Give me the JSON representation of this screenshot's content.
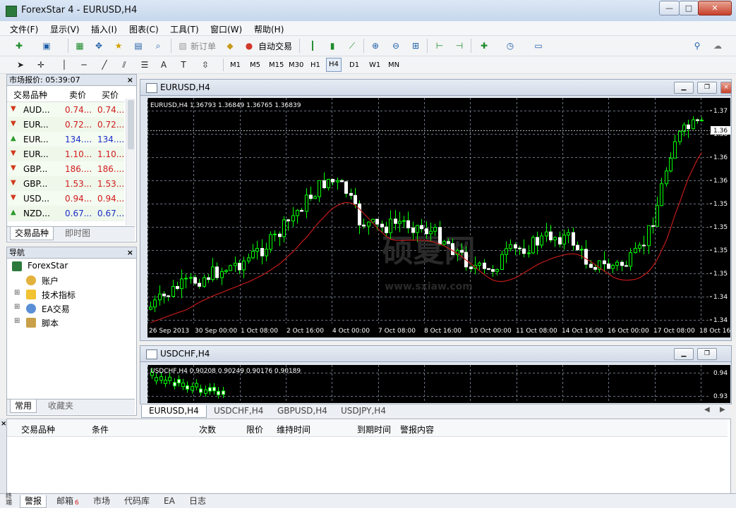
{
  "window": {
    "title": "ForexStar 4 - EURUSD,H4",
    "min": "—",
    "max": "□",
    "close": "✕"
  },
  "menu": [
    "文件(F)",
    "显示(V)",
    "插入(I)",
    "图表(C)",
    "工具(T)",
    "窗口(W)",
    "帮助(H)"
  ],
  "toolbar": {
    "new_order": "新订单",
    "auto_trade": "自动交易"
  },
  "timeframes": [
    "M1",
    "M5",
    "M15",
    "M30",
    "H1",
    "H4",
    "D1",
    "W1",
    "MN"
  ],
  "active_timeframe": "H4",
  "market_watch": {
    "title": "市场报价: 05:39:07",
    "col_symbol": "交易品种",
    "col_bid": "卖价",
    "col_ask": "买价",
    "rows": [
      {
        "symbol": "AUD...",
        "bid": "0.74...",
        "ask": "0.74...",
        "dir": "down"
      },
      {
        "symbol": "EUR...",
        "bid": "0.72...",
        "ask": "0.72...",
        "dir": "down"
      },
      {
        "symbol": "EUR...",
        "bid": "134....",
        "ask": "134....",
        "dir": "up"
      },
      {
        "symbol": "EUR...",
        "bid": "1.10...",
        "ask": "1.10...",
        "dir": "down"
      },
      {
        "symbol": "GBP...",
        "bid": "186....",
        "ask": "186....",
        "dir": "down"
      },
      {
        "symbol": "GBP...",
        "bid": "1.53...",
        "ask": "1.53...",
        "dir": "down"
      },
      {
        "symbol": "USD...",
        "bid": "0.94...",
        "ask": "0.94...",
        "dir": "down"
      },
      {
        "symbol": "NZD...",
        "bid": "0.67...",
        "ask": "0.67...",
        "dir": "up"
      }
    ],
    "tabs": [
      "交易品种",
      "即时图"
    ]
  },
  "navigator": {
    "title": "导航",
    "root": "ForexStar",
    "items": [
      "账户",
      "技术指标",
      "EA交易",
      "脚本"
    ],
    "tabs": [
      "常用",
      "收藏夹"
    ]
  },
  "chart_main": {
    "title": "EURUSD,H4",
    "info": "EURUSD,H4  1.36793 1.36849 1.36765 1.36839",
    "price_labels": [
      "1.37",
      "1.36",
      "1.36",
      "1.36",
      "1.35",
      "1.35",
      "1.35",
      "1.35",
      "1.34",
      "1.34"
    ],
    "current_price": "1.36",
    "time_labels": [
      "26 Sep 2013",
      "30 Sep 00:00",
      "1 Oct 08:00",
      "2 Oct 16:00",
      "4 Oct 00:00",
      "7 Oct 08:00",
      "8 Oct 16:00",
      "10 Oct 00:00",
      "11 Oct 08:00",
      "14 Oct 16:00",
      "16 Oct 00:00",
      "17 Oct 08:00",
      "18 Oct 16:00"
    ],
    "watermark": "硕夏网",
    "watermark_url": "www.sxiaw.com",
    "colors": {
      "bg": "#000000",
      "up": "#00ff00",
      "ma": "#c41a1a",
      "grid": "#6a7282"
    }
  },
  "chart_second": {
    "title": "USDCHF,H4",
    "info": "USDCHF,H4  0.90208 0.90249 0.90176 0.90189",
    "price_labels": [
      "0.94",
      "0.93"
    ]
  },
  "chart_tabs": [
    "EURUSD,H4",
    "USDCHF,H4",
    "GBPUSD,H4",
    "USDJPY,H4"
  ],
  "terminal": {
    "headers": [
      "交易品种",
      "条件",
      "次数",
      "限价",
      "维持时间",
      "到期时间",
      "警报内容"
    ],
    "tabs": [
      "警报",
      "邮箱",
      "市场",
      "代码库",
      "EA",
      "日志"
    ],
    "mail_badge": "6",
    "side_label": "终端"
  }
}
